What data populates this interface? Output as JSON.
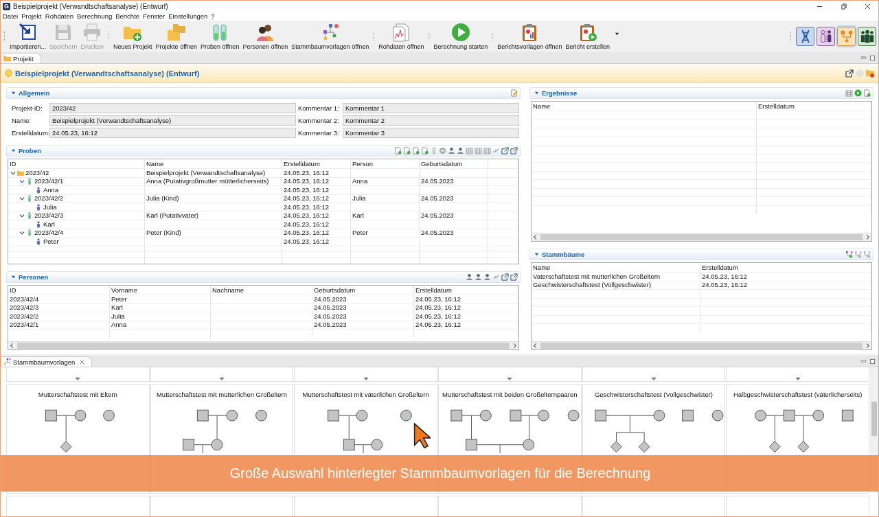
{
  "window": {
    "logo": "G",
    "title": "Beispielprojekt (Verwandtschaftsanalyse) (Entwurf)"
  },
  "menu": [
    "Datei",
    "Projekt",
    "Rohdaten",
    "Berechnung",
    "Berichte",
    "Fenster",
    "Einstellungen",
    "?"
  ],
  "toolbar": [
    {
      "label": "Importieren...",
      "kind": "import",
      "disabled": false,
      "separator_after": false
    },
    {
      "label": "Speichern",
      "kind": "save",
      "disabled": true,
      "separator_after": false
    },
    {
      "label": "Drucken",
      "kind": "print",
      "disabled": true,
      "separator_after": true
    },
    {
      "label": "Neues Projekt",
      "kind": "new_project",
      "disabled": false,
      "separator_after": false
    },
    {
      "label": "Projekte öffnen",
      "kind": "open_projects",
      "disabled": false,
      "separator_after": false
    },
    {
      "label": "Proben öffnen",
      "kind": "samples",
      "disabled": false,
      "separator_after": false
    },
    {
      "label": "Personen öffnen",
      "kind": "persons",
      "disabled": false,
      "separator_after": false
    },
    {
      "label": "Stammbaumvorlagen öffnen",
      "kind": "pedigree",
      "disabled": false,
      "separator_after": true
    },
    {
      "label": "Rohdaten öffnen",
      "kind": "raw_data",
      "disabled": false,
      "separator_after": true
    },
    {
      "label": "Berechnung starten",
      "kind": "run",
      "disabled": false,
      "separator_after": true
    },
    {
      "label": "Berichtsvorlagen öffnen",
      "kind": "report_templates",
      "disabled": false,
      "separator_after": false
    },
    {
      "label": "Bericht erstellen",
      "kind": "create_report",
      "disabled": false,
      "separator_after": false
    }
  ],
  "perspectives": [
    {
      "kind": "dna",
      "selected": false
    },
    {
      "kind": "persons",
      "selected": false
    },
    {
      "kind": "pedigree",
      "selected": true
    },
    {
      "kind": "group",
      "selected": false
    }
  ],
  "view_tab": {
    "label": "Projekt"
  },
  "project": {
    "title": "Beispielprojekt (Verwandtschaftsanalyse) (Entwurf)"
  },
  "general": {
    "title": "Allgemein",
    "fields": [
      {
        "label": "Projekt-ID:",
        "value": "2023/42"
      },
      {
        "label": "Name:",
        "value": "Beispielprojekt (Verwandtschaftsanalyse)"
      },
      {
        "label": "Erstelldatum:",
        "value": "24.05.23, 16:12"
      }
    ],
    "comments": [
      {
        "label": "Kommentar 1:",
        "value": "Kommentar 1"
      },
      {
        "label": "Kommentar 2:",
        "value": "Kommentar 2"
      },
      {
        "label": "Kommentar 3:",
        "value": "Kommentar 3"
      }
    ]
  },
  "samples": {
    "title": "Proben",
    "columns": [
      "ID",
      "Name",
      "Erstelldatum",
      "Person",
      "Geburtsdatum"
    ],
    "rows": [
      {
        "kind": "project",
        "id": "2023/42",
        "name": "Beispielprojekt (Verwandtschaftsanalyse)",
        "created": "24.05.23, 16:12",
        "expanded": true,
        "children": [
          {
            "kind": "sample",
            "id": "2023/42/1",
            "name": "Anna (Putativgroßmutter mütterlicherseits)",
            "created": "24.05.23, 16:12",
            "person": "Anna",
            "birth": "24.05.2023",
            "expanded": true,
            "children": [
              {
                "kind": "person",
                "id": "Anna",
                "created": "24.05.23, 16:12"
              }
            ]
          },
          {
            "kind": "sample",
            "id": "2023/42/2",
            "name": "Julia (Kind)",
            "created": "24.05.23, 16:12",
            "person": "Julia",
            "birth": "24.05.2023",
            "expanded": true,
            "children": [
              {
                "kind": "person",
                "id": "Julia",
                "created": "24.05.23, 16:12"
              }
            ]
          },
          {
            "kind": "sample",
            "id": "2023/42/3",
            "name": "Karl (Putativvater)",
            "created": "24.05.23, 16:12",
            "person": "Karl",
            "birth": "24.05.2023",
            "expanded": true,
            "children": [
              {
                "kind": "person",
                "id": "Karl",
                "created": "24.05.23, 16:12"
              }
            ]
          },
          {
            "kind": "sample",
            "id": "2023/42/4",
            "name": "Peter (Kind)",
            "created": "24.05.23, 16:12",
            "person": "Peter",
            "birth": "24.05.2023",
            "expanded": true,
            "children": [
              {
                "kind": "person",
                "id": "Peter",
                "created": "24.05.23, 16:12"
              }
            ]
          }
        ]
      }
    ]
  },
  "persons": {
    "title": "Personen",
    "columns": [
      "ID",
      "Vorname",
      "Nachname",
      "Geburtsdatum",
      "Erstelldatum"
    ],
    "rows": [
      {
        "id": "2023/42/4",
        "first_name": "Peter",
        "birth": "24.05.2023",
        "created": "24.05.23, 16:12"
      },
      {
        "id": "2023/42/3",
        "first_name": "Karl",
        "birth": "24.05.2023",
        "created": "24.05.23, 16:12"
      },
      {
        "id": "2023/42/2",
        "first_name": "Julia",
        "birth": "24.05.2023",
        "created": "24.05.23, 16:12"
      },
      {
        "id": "2023/42/1",
        "first_name": "Anna",
        "birth": "24.05.2023",
        "created": "24.05.23, 16:12"
      }
    ]
  },
  "results": {
    "title": "Ergebnisse",
    "columns": [
      "Name",
      "Erstelldatum"
    ]
  },
  "pedigrees": {
    "title": "Stammbäume",
    "columns": [
      "Name",
      "Erstelldatum"
    ],
    "rows": [
      {
        "name": "Vaterschaftstest mit mütterlichen Großeltern",
        "created": "24.05.23, 16:12"
      },
      {
        "name": "Geschwisterschaftstest (Vollgeschwister)",
        "created": "24.05.23, 16:12"
      }
    ]
  },
  "templates_view": {
    "tab": "Stammbaumvorlagen",
    "cards": [
      {
        "title": "Mutterschaftstest mit Eltern",
        "kind": "mother_parents"
      },
      {
        "title": "Mutterschaftstest mit mütterlichen Großeltern",
        "kind": "mother_maternal_gp"
      },
      {
        "title": "Mutterschaftstest mit väterlichen Großeltern",
        "kind": "mother_paternal_gp"
      },
      {
        "title": "Mutterschaftstest mit beiden Großelternpaaren",
        "kind": "mother_both_gp"
      },
      {
        "title": "Geschwisterschaftstest (Vollgeschwister)",
        "kind": "full_siblings"
      },
      {
        "title": "Halbgeschwisterschaftstest (väterlicherseits)",
        "kind": "half_siblings_paternal"
      }
    ]
  },
  "caption": "Große Auswahl hinterlegter Stammbaumvorlagen für die Berechnung"
}
